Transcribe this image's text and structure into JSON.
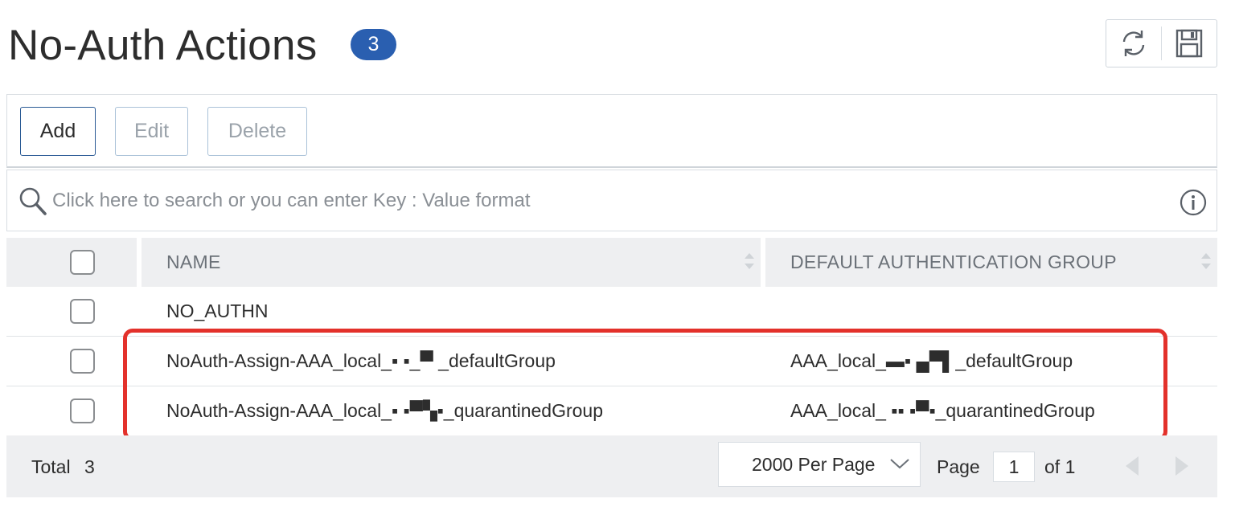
{
  "header": {
    "title": "No-Auth Actions",
    "count": "3",
    "tools": [
      {
        "icon": "refresh-icon"
      },
      {
        "icon": "save-icon"
      }
    ]
  },
  "toolbar": {
    "add_label": "Add",
    "edit_label": "Edit",
    "delete_label": "Delete"
  },
  "search": {
    "placeholder": "Click here to search or you can enter Key : Value format",
    "icon": "search-icon",
    "info_icon": "info-icon"
  },
  "table": {
    "columns": [
      {
        "label": "NAME"
      },
      {
        "label": "DEFAULT AUTHENTICATION GROUP"
      }
    ],
    "rows": [
      {
        "name": "NO_AUTHN",
        "group": ""
      },
      {
        "name": "NoAuth-Assign-AAA_local_▪ ▪_▀ _defaultGroup",
        "group": "AAA_local_▬▪ ▄▀▌_defaultGroup"
      },
      {
        "name": "NoAuth-Assign-AAA_local_▪ ▪▀▚▪_quarantinedGroup",
        "group": "AAA_local_ ▪▪ ▪▀▪_quarantinedGroup"
      }
    ]
  },
  "footer": {
    "total_label": "Total",
    "total_count": "3",
    "per_page": "2000 Per Page",
    "page_label": "Page",
    "page_value": "1",
    "of_label": "of 1"
  },
  "colors": {
    "badge": "#2a5fb0",
    "primary_border": "#2a5a95",
    "highlight": "#e3312b",
    "header_bg": "#eeeff1"
  }
}
